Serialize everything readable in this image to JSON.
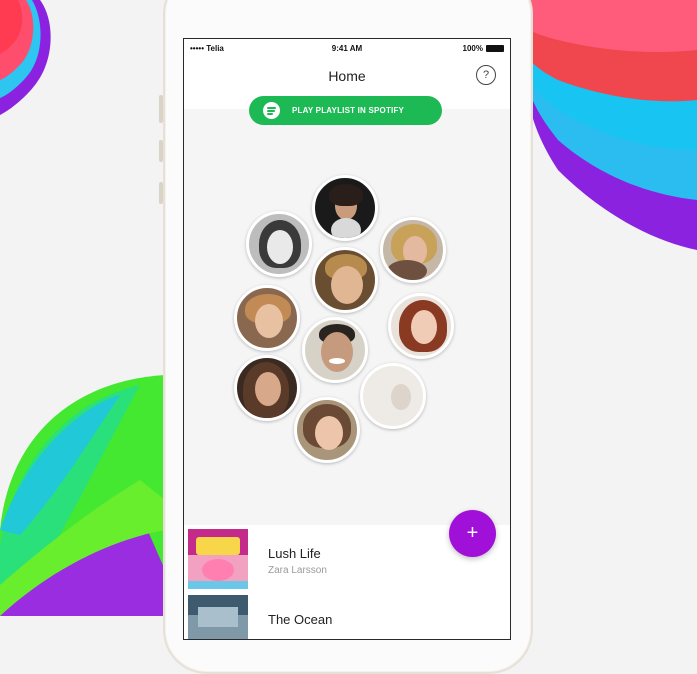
{
  "status_bar": {
    "carrier": "••••• Telia",
    "time": "9:41 AM",
    "battery": "100%"
  },
  "nav": {
    "title": "Home",
    "help_label": "?"
  },
  "spotify_button": {
    "label": "PLAY PLAYLIST IN SPOTIFY",
    "icon": "spotify-icon"
  },
  "tracks": [
    {
      "title": "Lush Life",
      "artist": "Zara Larsson"
    },
    {
      "title": "The Ocean",
      "artist": ""
    }
  ],
  "fab": {
    "label": "+"
  },
  "colors": {
    "spotify_green": "#1db954",
    "fab_purple": "#a010d8"
  }
}
